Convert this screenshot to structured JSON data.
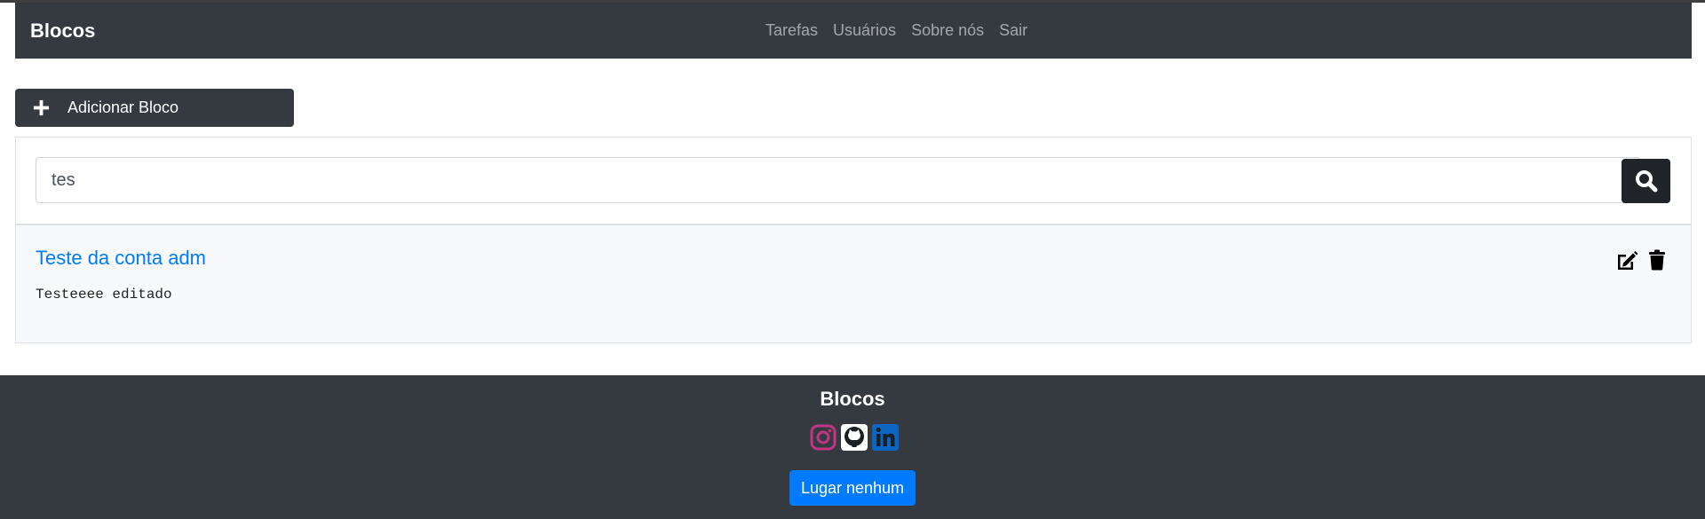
{
  "navbar": {
    "brand": "Blocos",
    "links": [
      {
        "label": "Tarefas"
      },
      {
        "label": "Usuários"
      },
      {
        "label": "Sobre nós"
      },
      {
        "label": "Sair"
      }
    ]
  },
  "toolbar": {
    "add_label": "Adicionar Bloco"
  },
  "search": {
    "value": "tes",
    "icon": "search-icon"
  },
  "results": [
    {
      "title": "Teste da conta adm",
      "description": "Testeeee editado"
    }
  ],
  "footer": {
    "title": "Blocos",
    "social_icons": [
      "instagram-icon",
      "github-icon",
      "linkedin-icon"
    ],
    "place_button": "Lugar nenhum"
  },
  "colors": {
    "dark": "#343a40",
    "link_blue": "#007bff",
    "instagram": "#c13584",
    "linkedin": "#0a66c2"
  }
}
